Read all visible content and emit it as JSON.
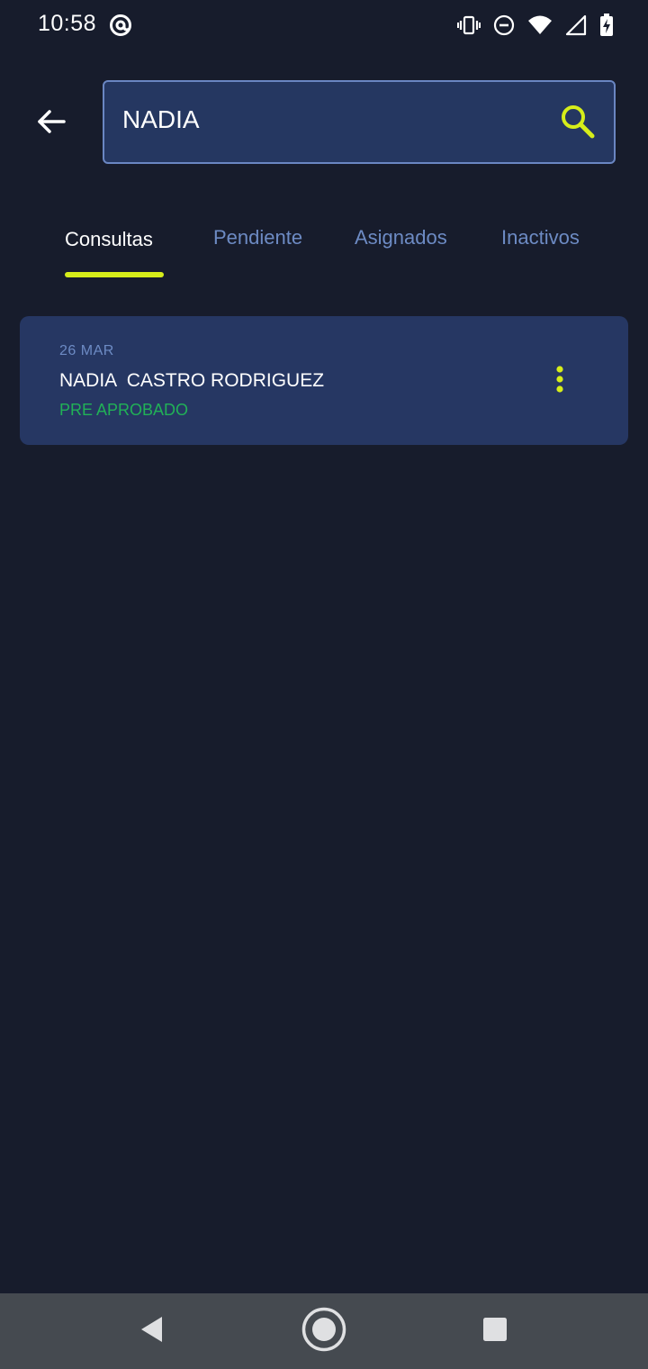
{
  "status_bar": {
    "time": "10:58",
    "icons": [
      "at-sign-icon",
      "vibrate-icon",
      "do-not-disturb-icon",
      "wifi-icon",
      "signal-icon",
      "battery-charging-icon"
    ]
  },
  "header": {
    "back_icon": "arrow-left-icon",
    "search": {
      "value": "NADIA",
      "placeholder": "",
      "icon": "search-icon"
    }
  },
  "tabs": [
    {
      "label": "Consultas",
      "active": true
    },
    {
      "label": "Pendiente",
      "active": false
    },
    {
      "label": "Asignados",
      "active": false
    },
    {
      "label": "Inactivos",
      "active": false
    }
  ],
  "results": [
    {
      "date": "26 MAR",
      "name": "NADIA  CASTRO RODRIGUEZ",
      "status": "PRE APROBADO",
      "menu_icon": "more-vertical-icon"
    }
  ],
  "nav_bar": {
    "icons": [
      "back-triangle-icon",
      "home-circle-icon",
      "recents-square-icon"
    ]
  },
  "colors": {
    "background": "#171c2c",
    "card": "#263763",
    "accent": "#d6ed1a",
    "status_approved": "#21b157",
    "inactive_tab": "#6d8bc4",
    "nav_bar": "#454a50"
  }
}
